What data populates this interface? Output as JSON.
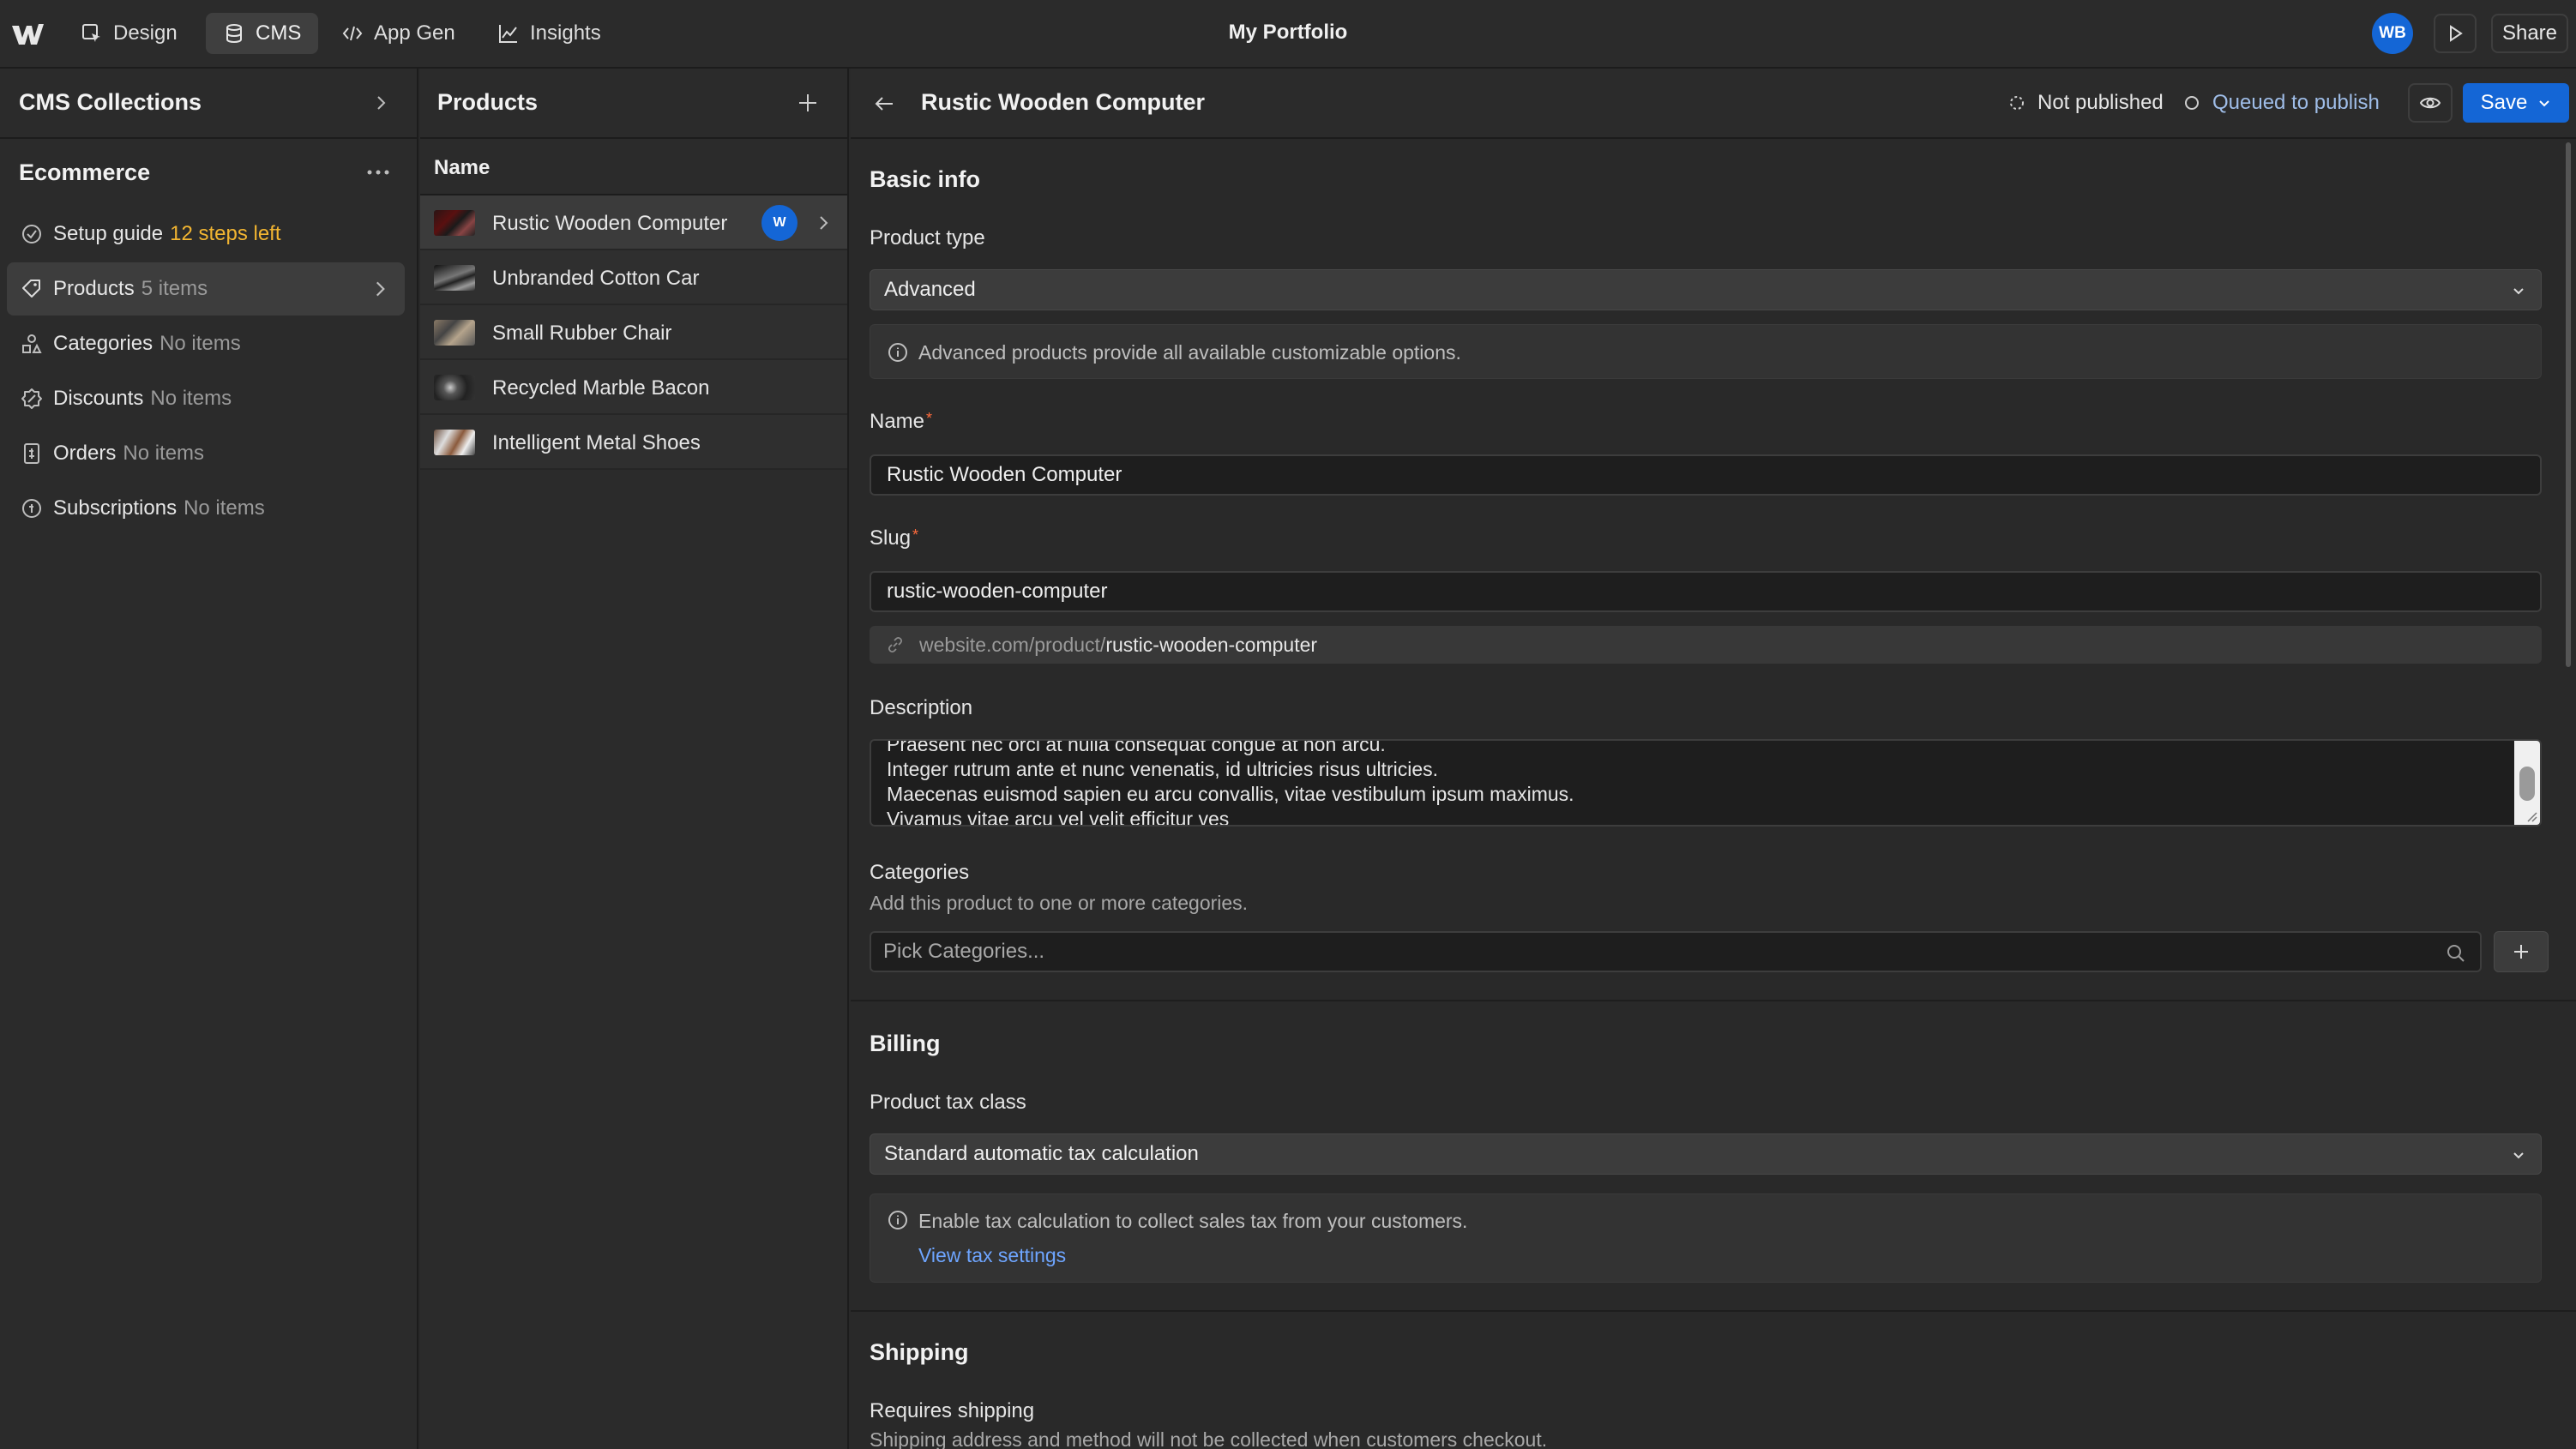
{
  "topbar": {
    "tabs": [
      {
        "label": "Design",
        "icon": "design-cursor-icon"
      },
      {
        "label": "CMS",
        "icon": "database-icon"
      },
      {
        "label": "App Gen",
        "icon": "code-icon"
      },
      {
        "label": "Insights",
        "icon": "chart-line-icon"
      }
    ],
    "active_tab": "CMS",
    "app_title": "My Portfolio",
    "avatar_initials": "WB",
    "share_label": "Share"
  },
  "sidebar": {
    "title": "CMS Collections",
    "section_title": "Ecommerce",
    "items": [
      {
        "label": "Setup guide",
        "meta": "12 steps left",
        "icon": "check-circle-icon"
      },
      {
        "label": "Products",
        "meta": "5 items",
        "icon": "tag-icon"
      },
      {
        "label": "Categories",
        "meta": "No items",
        "icon": "shapes-icon"
      },
      {
        "label": "Discounts",
        "meta": "No items",
        "icon": "discount-badge-icon"
      },
      {
        "label": "Orders",
        "meta": "No items",
        "icon": "receipt-icon"
      },
      {
        "label": "Subscriptions",
        "meta": "No items",
        "icon": "subscription-icon"
      }
    ]
  },
  "products": {
    "title": "Products",
    "column_header": "Name",
    "rows": [
      {
        "name": "Rustic Wooden Computer",
        "badge": "W"
      },
      {
        "name": "Unbranded Cotton Car"
      },
      {
        "name": "Small Rubber Chair"
      },
      {
        "name": "Recycled Marble Bacon"
      },
      {
        "name": "Intelligent Metal Shoes"
      }
    ]
  },
  "editor": {
    "title": "Rustic Wooden Computer",
    "status_not_published": "Not published",
    "status_queued": "Queued to publish",
    "save_label": "Save",
    "basic_info": {
      "heading": "Basic info",
      "product_type_label": "Product type",
      "product_type_value": "Advanced",
      "product_type_info": "Advanced products provide all available customizable options.",
      "name_label": "Name",
      "name_value": "Rustic Wooden Computer",
      "slug_label": "Slug",
      "slug_value": "rustic-wooden-computer",
      "url_base": "website.com/product/",
      "url_slug": "rustic-wooden-computer",
      "description_label": "Description",
      "description_lines": [
        "Praesent nec orci at nulla consequat congue at non arcu.",
        "Integer rutrum ante et nunc venenatis, id ultricies risus ultricies.",
        "Maecenas euismod sapien eu arcu convallis, vitae vestibulum ipsum maximus.",
        "Vivamus vitae arcu vel velit efficitur ves"
      ],
      "categories_label": "Categories",
      "categories_help": "Add this product to one or more categories.",
      "categories_placeholder": "Pick Categories..."
    },
    "billing": {
      "heading": "Billing",
      "tax_class_label": "Product tax class",
      "tax_class_value": "Standard automatic tax calculation",
      "tax_info": "Enable tax calculation to collect sales tax from your customers.",
      "tax_link": "View tax settings"
    },
    "shipping": {
      "heading": "Shipping",
      "requires_label": "Requires shipping",
      "requires_help": "Shipping address and method will not be collected when customers checkout."
    }
  },
  "colors": {
    "accent": "#1466d6",
    "warning": "#f2b531",
    "required": "#ff6b3d",
    "link": "#6ea5ff",
    "background": "#292929"
  }
}
